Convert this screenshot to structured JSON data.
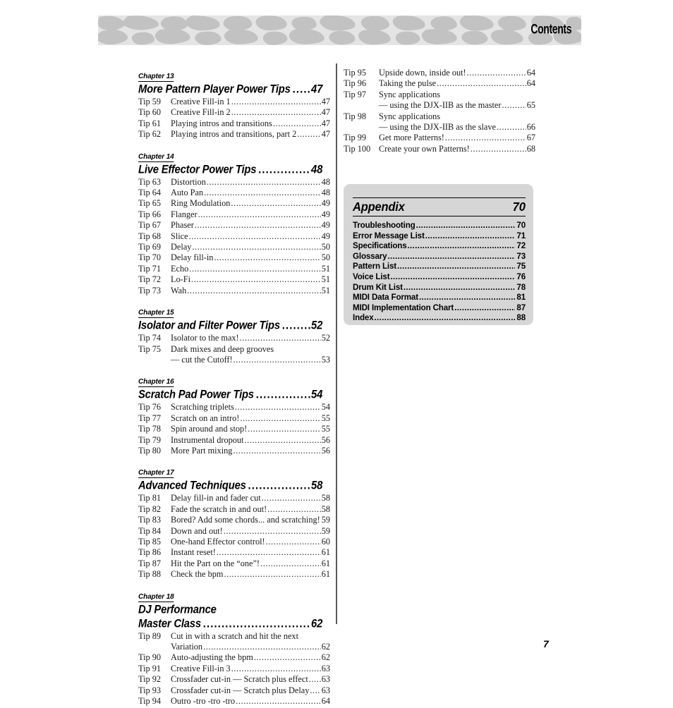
{
  "header": {
    "title": "Contents",
    "pattern_bg_color": "#e4e4e4",
    "pattern_blob_color": "#c2c2c2"
  },
  "page_number": "7",
  "left_column": {
    "chapters": [
      {
        "label": "Chapter 13",
        "title": "More Pattern Player Power Tips",
        "page": "47",
        "dots": "...",
        "tips": [
          {
            "num": "Tip 59",
            "text": "Creative Fill-in 1",
            "page": "47"
          },
          {
            "num": "Tip 60",
            "text": "Creative Fill-in 2",
            "page": "47"
          },
          {
            "num": "Tip 61",
            "text": "Playing intros and transitions",
            "page": "47"
          },
          {
            "num": "Tip 62",
            "text": "Playing intros and transitions, part 2",
            "page": "47"
          }
        ]
      },
      {
        "label": "Chapter 14",
        "title": "Live Effector Power Tips",
        "page": "48",
        "dots": ".........",
        "tips": [
          {
            "num": "Tip 63",
            "text": "Distortion",
            "page": "48"
          },
          {
            "num": "Tip 64",
            "text": "Auto Pan",
            "page": "48"
          },
          {
            "num": "Tip 65",
            "text": "Ring Modulation",
            "page": "49"
          },
          {
            "num": "Tip 66",
            "text": "Flanger",
            "page": "49"
          },
          {
            "num": "Tip 67",
            "text": "Phaser",
            "page": "49"
          },
          {
            "num": "Tip 68",
            "text": "Slice",
            "page": "49"
          },
          {
            "num": "Tip 69",
            "text": "Delay",
            "page": "50"
          },
          {
            "num": "Tip 70",
            "text": "Delay fill-in",
            "page": "50"
          },
          {
            "num": "Tip 71",
            "text": "Echo",
            "page": "51"
          },
          {
            "num": "Tip 72",
            "text": "Lo-Fi",
            "page": "51"
          },
          {
            "num": "Tip 73",
            "text": "Wah",
            "page": "51"
          }
        ]
      },
      {
        "label": "Chapter 15",
        "title": "Isolator and Filter Power Tips",
        "page": "52",
        "dots": "...",
        "tips": [
          {
            "num": "Tip 74",
            "text": "Isolator to the max!",
            "page": "52"
          },
          {
            "num": "Tip 75",
            "text": "Dark mixes and deep grooves",
            "page": "",
            "nodots": true
          },
          {
            "num": "",
            "text": "— cut the Cutoff!",
            "page": "53",
            "cont": true
          }
        ]
      },
      {
        "label": "Chapter 16",
        "title": "Scratch Pad Power Tips",
        "page": "54",
        "dots": "...........",
        "tips": [
          {
            "num": "Tip 76",
            "text": "Scratching triplets",
            "page": "54"
          },
          {
            "num": "Tip 77",
            "text": "Scratch on an intro!",
            "page": "55"
          },
          {
            "num": "Tip 78",
            "text": "Spin around and stop!",
            "page": "55"
          },
          {
            "num": "Tip 79",
            "text": "Instrumental dropout",
            "page": "56"
          },
          {
            "num": "Tip 80",
            "text": "More Part mixing",
            "page": "56"
          }
        ]
      },
      {
        "label": "Chapter 17",
        "title": "Advanced Techniques",
        "page": "58",
        "dots": "..............",
        "tips": [
          {
            "num": "Tip 81",
            "text": "Delay fill-in and fader cut",
            "page": "58"
          },
          {
            "num": "Tip 82",
            "text": "Fade the scratch in and out!",
            "page": "58"
          },
          {
            "num": "Tip 83",
            "text": "Bored?  Add some chords... and scratching!",
            "page": "59"
          },
          {
            "num": "Tip 84",
            "text": "Down and out!",
            "page": "59"
          },
          {
            "num": "Tip 85",
            "text": "One-hand Effector control!",
            "page": "60"
          },
          {
            "num": "Tip 86",
            "text": "Instant reset!",
            "page": "61"
          },
          {
            "num": "Tip 87",
            "text": "Hit the Part on the “one”!",
            "page": "61"
          },
          {
            "num": "Tip 88",
            "text": "Check the bpm",
            "page": "61"
          }
        ]
      },
      {
        "label": "Chapter 18",
        "title_line1": "DJ Performance",
        "title": "Master Class",
        "page": "62",
        "dots": "............................",
        "tips": [
          {
            "num": "Tip 89",
            "text": "Cut in with a scratch and hit the next",
            "page": "",
            "nodots": true
          },
          {
            "num": "",
            "text": "Variation",
            "page": "62",
            "cont": true
          },
          {
            "num": "Tip 90",
            "text": "Auto-adjusting the bpm",
            "page": "62"
          },
          {
            "num": "Tip 91",
            "text": "Creative Fill-in 3",
            "page": "63"
          },
          {
            "num": "Tip 92",
            "text": "Crossfader cut-in — Scratch plus effect",
            "page": "63"
          },
          {
            "num": "Tip 93",
            "text": "Crossfader cut-in — Scratch plus Delay",
            "page": "63"
          },
          {
            "num": "Tip 94",
            "text": "Outro -tro -tro -tro",
            "page": "64"
          }
        ]
      }
    ]
  },
  "right_column": {
    "tips": [
      {
        "num": "Tip 95",
        "text": "Upside down, inside out!",
        "page": "64"
      },
      {
        "num": "Tip 96",
        "text": "Taking the pulse",
        "page": "64"
      },
      {
        "num": "Tip 97",
        "text": "Sync applications",
        "page": "",
        "nodots": true
      },
      {
        "num": "",
        "text": "— using the DJX-IIB as the master",
        "page": "65",
        "cont": true
      },
      {
        "num": "Tip 98",
        "text": "Sync applications",
        "page": "",
        "nodots": true
      },
      {
        "num": "",
        "text": "— using the DJX-IIB as the slave",
        "page": "66",
        "cont": true
      },
      {
        "num": "Tip 99",
        "text": "Get more Patterns!",
        "page": "67"
      },
      {
        "num": "Tip 100",
        "text": "Create your own Patterns!",
        "page": "68"
      }
    ]
  },
  "appendix": {
    "title": "Appendix",
    "page": "70",
    "box_color": "#d6d6d6",
    "entries": [
      {
        "text": "Troubleshooting",
        "page": "70"
      },
      {
        "text": "Error Message List",
        "page": "71"
      },
      {
        "text": "Specifications",
        "page": "72"
      },
      {
        "text": "Glossary",
        "page": "73"
      },
      {
        "text": "Pattern List",
        "page": "75"
      },
      {
        "text": "Voice List",
        "page": "76"
      },
      {
        "text": "Drum Kit List",
        "page": "78"
      },
      {
        "text": "MIDI Data Format",
        "page": "81"
      },
      {
        "text": "MIDI Implementation Chart",
        "page": "87"
      },
      {
        "text": "Index",
        "page": "88"
      }
    ]
  }
}
